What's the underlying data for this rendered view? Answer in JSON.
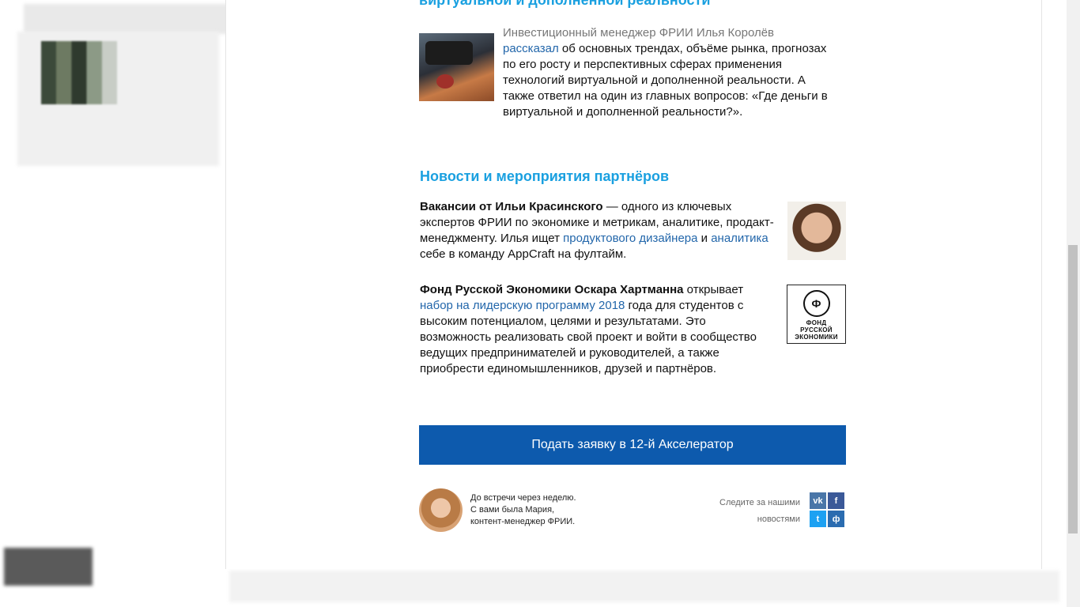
{
  "article": {
    "heading_cut": "виртуальной и дополненной реальности",
    "p1_faded": "Инвестиционный менеджер ФРИИ Илья Королёв",
    "p1_link": "рассказал",
    "p1_rest": " об основных трендах, объёме рынка, прогнозах по его росту и перспективных сферах применения технологий виртуальной и дополненной реальности. А также ответил на один из главных вопросов: «Где деньги в виртуальной и дополненной реальности?»."
  },
  "partners": {
    "heading": "Новости и мероприятия партнёров",
    "item1": {
      "bold": "Вакансии от Ильи Красинского",
      "text1": " — одного из ключевых экспертов ФРИИ по экономике и метрикам, аналитике, продакт-менеджменту. Илья ищет ",
      "link1": "продуктового дизайнера",
      "text2": " и ",
      "link2": "аналитика",
      "text3": " себе в команду AppCraft на фултайм."
    },
    "item2": {
      "bold": "Фонд Русской Экономики Оскара Хартманна",
      "text1": " открывает ",
      "link1": "набор на лидерскую программу 2018",
      "text2": " года для студентов с высоким потенциалом, целями и результатами. Это возможность реализовать свой проект и войти в сообщество ведущих предпринимателей и руководителей, а также приобрести единомышленников, друзей и партнёров."
    },
    "logo": {
      "symbol": "Ф",
      "line1": "ФОНД",
      "line2": "РУССКОЙ",
      "line3": "ЭКОНОМИКИ"
    }
  },
  "cta": {
    "label": "Подать заявку в 12-й Акселератор"
  },
  "footer": {
    "sign_line1": "До встречи через неделю.",
    "sign_line2": "С вами была Мария,",
    "sign_line3": "контент-менеджер ФРИИ.",
    "follow_line1": "Следите за нашими",
    "follow_line2": "новостями",
    "vk": "vk",
    "fb": "f",
    "tw": "t",
    "fr": "ф"
  },
  "colors": {
    "heading": "#1aa0e0",
    "link": "#2266aa",
    "cta_bg": "#0d5aad"
  }
}
